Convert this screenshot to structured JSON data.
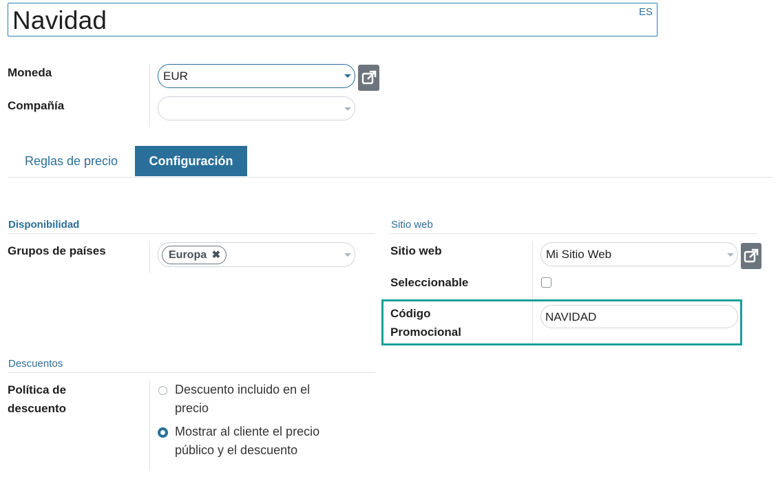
{
  "record": {
    "name": "Navidad",
    "lang_badge": "ES"
  },
  "fields": {
    "currency": {
      "label": "Moneda",
      "value": "EUR"
    },
    "company": {
      "label": "Compañía",
      "value": ""
    }
  },
  "tabs": [
    {
      "label": "Reglas de precio",
      "active": false
    },
    {
      "label": "Configuración",
      "active": true
    }
  ],
  "availability": {
    "section_title": "Disponibilidad",
    "country_groups_label": "Grupos de países",
    "country_groups_tags": [
      "Europa"
    ]
  },
  "website": {
    "section_title": "Sitio web",
    "website_label": "Sitio web",
    "website_value": "Mi Sitio Web",
    "selectable_label": "Seleccionable",
    "selectable_checked": false,
    "promo_label_line1": "Código",
    "promo_label_line2": "Promocional",
    "promo_value": "NAVIDAD"
  },
  "discounts": {
    "section_title": "Descuentos",
    "policy_label_line1": "Política de",
    "policy_label_line2": "descuento",
    "options": [
      {
        "line1": "Descuento incluido en el",
        "line2": "precio",
        "selected": false
      },
      {
        "line1": "Mostrar al cliente el precio",
        "line2": "público y el descuento",
        "selected": true
      }
    ]
  },
  "colors": {
    "primary": "#2a6f9a",
    "highlight": "#17a097",
    "secondary_button": "#6c757d"
  },
  "icons": {
    "external_link": "external-link-icon",
    "remove_tag": "close-icon",
    "dropdown": "caret-down-icon"
  }
}
